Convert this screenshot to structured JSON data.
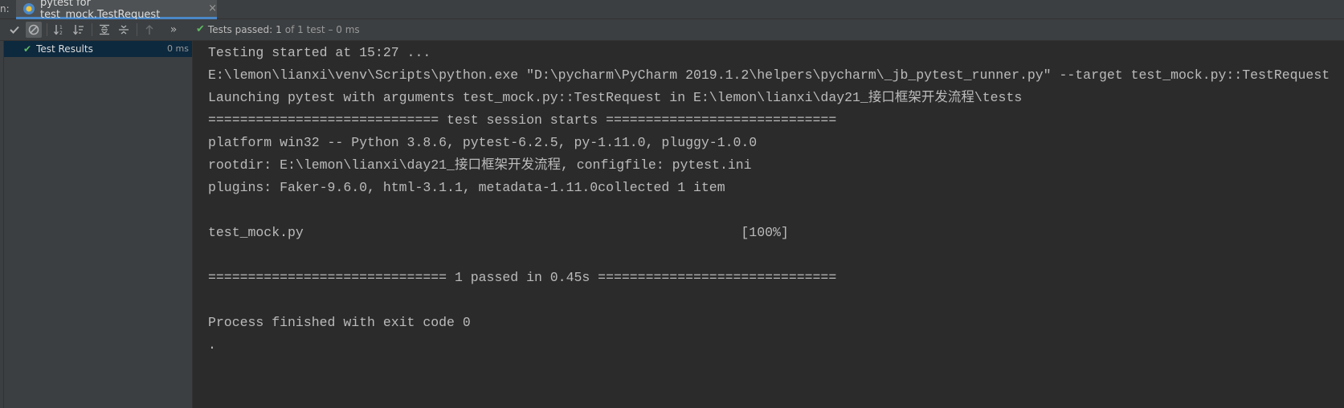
{
  "window": {
    "run_label": "n:",
    "tab_title": "pytest for test_mock.TestRequest",
    "tab_close": "×"
  },
  "toolbar": {
    "status_label": "Tests passed:",
    "status_count": "1",
    "status_detail": "of 1 test – 0 ms",
    "icons": [
      "check-icon",
      "stop-icon",
      "sort-alpha-icon",
      "sort-duration-icon",
      "expand-all-icon",
      "collapse-all-icon",
      "up-arrow-icon",
      "more-icon"
    ],
    "more": "»"
  },
  "tree": {
    "root_label": "Test Results",
    "root_time": "0 ms"
  },
  "console": {
    "lines": [
      "Testing started at 15:27 ...",
      "E:\\lemon\\lianxi\\venv\\Scripts\\python.exe \"D:\\pycharm\\PyCharm 2019.1.2\\helpers\\pycharm\\_jb_pytest_runner.py\" --target test_mock.py::TestRequest",
      "Launching pytest with arguments test_mock.py::TestRequest in E:\\lemon\\lianxi\\day21_接口框架开发流程\\tests",
      "============================= test session starts =============================",
      "platform win32 -- Python 3.8.6, pytest-6.2.5, py-1.11.0, pluggy-1.0.0",
      "rootdir: E:\\lemon\\lianxi\\day21_接口框架开发流程, configfile: pytest.ini",
      "plugins: Faker-9.6.0, html-3.1.1, metadata-1.11.0collected 1 item",
      "",
      "test_mock.py                                                       [100%]",
      "",
      "============================== 1 passed in 0.45s ==============================",
      "",
      "Process finished with exit code 0",
      "."
    ]
  }
}
